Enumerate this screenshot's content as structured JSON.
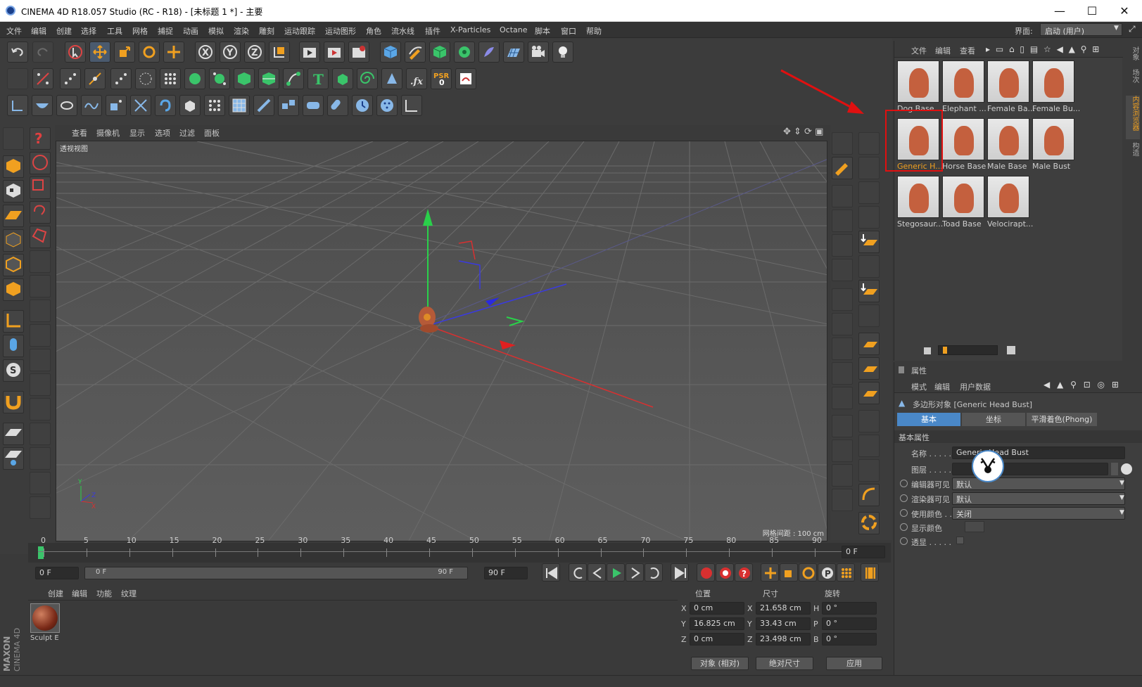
{
  "window": {
    "title": "CINEMA 4D R18.057 Studio (RC - R18) - [未标题 1 *] - 主要",
    "controls": [
      "—",
      "☐",
      "✕"
    ]
  },
  "menubar": {
    "items": [
      "文件",
      "编辑",
      "创建",
      "选择",
      "工具",
      "网格",
      "捕捉",
      "动画",
      "模拟",
      "渲染",
      "雕刻",
      "运动跟踪",
      "运动图形",
      "角色",
      "流水线",
      "插件",
      "X-Particles",
      "Octane",
      "脚本",
      "窗口",
      "帮助"
    ],
    "layout_label": "界面:",
    "layout_value": "启动 (用户)"
  },
  "viewport": {
    "menu": [
      "查看",
      "摄像机",
      "显示",
      "选项",
      "过滤",
      "面板"
    ],
    "name": "透视视图",
    "grid_spacing": "网格间距 : 100 cm"
  },
  "timeline": {
    "ticks": [
      "0",
      "5",
      "10",
      "15",
      "20",
      "25",
      "30",
      "35",
      "40",
      "45",
      "50",
      "55",
      "60",
      "65",
      "70",
      "75",
      "80",
      "85",
      "90"
    ],
    "current_frame_display": "0 F",
    "start": "0 F",
    "range_start": "0 F",
    "range_end": "90 F",
    "end": "90 F"
  },
  "materials": {
    "menu": [
      "创建",
      "编辑",
      "功能",
      "纹理"
    ],
    "items": [
      {
        "name": "Sculpt E"
      }
    ]
  },
  "coords": {
    "headers": [
      "位置",
      "尺寸",
      "旋转"
    ],
    "rows": [
      {
        "axis": "X",
        "pos": "0 cm",
        "size_axis": "X",
        "size": "21.658 cm",
        "rot_axis": "H",
        "rot": "0 °"
      },
      {
        "axis": "Y",
        "pos": "16.825 cm",
        "size_axis": "Y",
        "size": "33.43 cm",
        "rot_axis": "P",
        "rot": "0 °"
      },
      {
        "axis": "Z",
        "pos": "0 cm",
        "size_axis": "Z",
        "size": "23.498 cm",
        "rot_axis": "B",
        "rot": "0 °"
      }
    ],
    "mode": "对象 (相对)",
    "size_mode": "绝对尺寸",
    "apply": "应用"
  },
  "content_browser": {
    "menu": [
      "文件",
      "编辑",
      "查看"
    ],
    "items": [
      {
        "label": "Dog Base"
      },
      {
        "label": "Elephant ..."
      },
      {
        "label": "Female Ba..."
      },
      {
        "label": "Female Bu..."
      },
      {
        "label": "Generic H...",
        "selected": true
      },
      {
        "label": "Horse Base"
      },
      {
        "label": "Male Base"
      },
      {
        "label": "Male Bust"
      },
      {
        "label": "Stegosaur..."
      },
      {
        "label": "Toad Base"
      },
      {
        "label": "Velocirapt..."
      }
    ]
  },
  "side_tabs": [
    "对象",
    "场次",
    "内容浏览器",
    "构造"
  ],
  "attributes": {
    "title": "属性",
    "menu": [
      "模式",
      "编辑",
      "用户数据"
    ],
    "object_title": "多边形对象 [Generic Head Bust]",
    "tabs": [
      "基本",
      "坐标",
      "平滑着色(Phong)"
    ],
    "section": "基本属性",
    "rows": [
      {
        "label": "名称 . . . . .",
        "value": "Generic Head Bust"
      },
      {
        "label": "图层 . . . . .",
        "value": ""
      },
      {
        "label": "编辑器可见",
        "value": "默认"
      },
      {
        "label": "渲染器可见",
        "value": "默认"
      },
      {
        "label": "使用颜色 . . .",
        "value": "关闭"
      },
      {
        "label": "显示颜色",
        "value": ""
      },
      {
        "label": "透显 . . . . .",
        "value": ""
      }
    ]
  },
  "logo": {
    "line1": "MAXON",
    "line2": "CINEMA 4D"
  },
  "colors": {
    "accent": "#4a88c8",
    "selection": "#e01010",
    "orange": "#e8a020"
  }
}
